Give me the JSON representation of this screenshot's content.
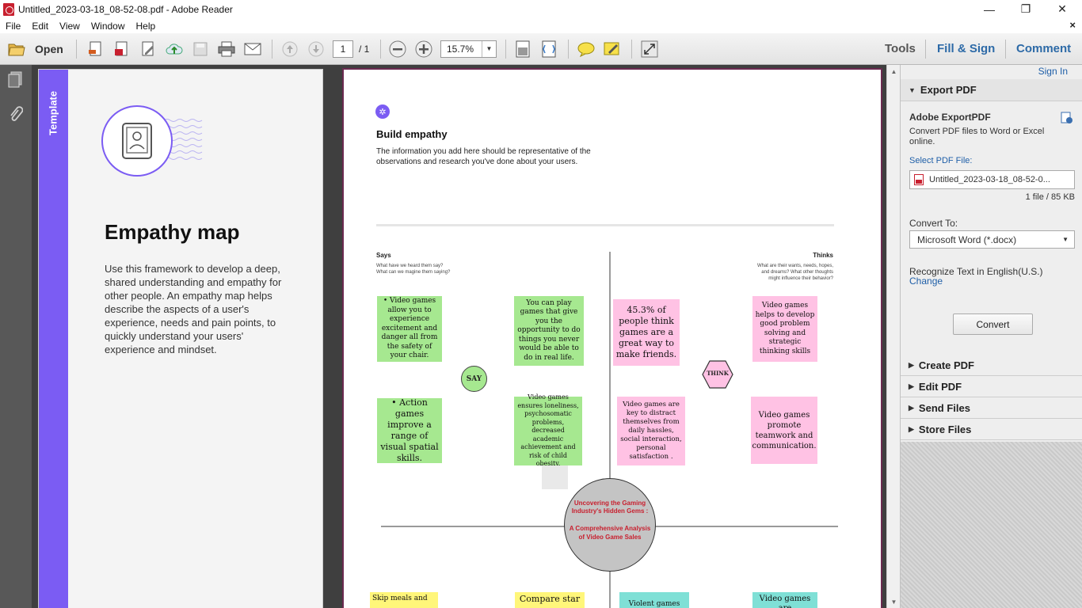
{
  "window": {
    "title": "Untitled_2023-03-18_08-52-08.pdf - Adobe Reader",
    "minimize": "—",
    "maximize": "❐",
    "close": "✕"
  },
  "menu": {
    "items": [
      "File",
      "Edit",
      "View",
      "Window",
      "Help"
    ],
    "close_doc": "×"
  },
  "toolbar": {
    "open_label": "Open",
    "page_current": "1",
    "page_total": "/ 1",
    "zoom": "15.7%",
    "tools": "Tools",
    "fill_sign": "Fill & Sign",
    "comment": "Comment"
  },
  "left_page": {
    "strip_label": "Template",
    "title": "Empathy map",
    "description": "Use this framework to develop a deep, shared understanding and empathy for other people. An empathy map helps describe the aspects of a user's experience, needs and pain points, to quickly understand your users' experience and mindset."
  },
  "right_page": {
    "heading": "Build empathy",
    "subtext": "The information you add here should be representative of the observations and research you've done about your users.",
    "says_label": "Says",
    "says_sub": "What have we heard them say?\nWhat can we magine them saying?",
    "thinks_label": "Thinks",
    "thinks_sub": "What are their wants, needs, hopes,\nand dreams? What other thoughts\nmight influence their behavior?",
    "say_badge": "SAY",
    "think_badge": "THINK",
    "center_title": "Uncovering the Gaming Industry's Hidden Gems :",
    "center_sub": "A Comprehensive Analysis of Video Game Sales",
    "notes": {
      "g1": "• Video games allow you to experience excitement and danger all from the safety of your chair.",
      "g2": "You can play games that give you the opportunity to do things you never would be able to do in real life.",
      "g3": "• Action games improve a range of visual spatial skills.",
      "g4": "Video games ensures loneliness, psychosomatic problems, decreased academic achievement and risk of child obesity.",
      "p1": "45.3% of people think games are a great way to make friends.",
      "p2": "Video games helps to develop good problem solving and strategic thinking skills",
      "p3": "Video games are key to distract themselves from daily hassles, social interaction, personal satisfaction .",
      "p4": "Video games promote teamwork and communication.",
      "y1": "Skip meals and",
      "y2": "Compare star",
      "t1": "Violent games",
      "t2": "Video games are"
    }
  },
  "right_panel": {
    "sign_in": "Sign In",
    "export_pdf": "Export PDF",
    "adobe_export": "Adobe ExportPDF",
    "export_desc": "Convert PDF files to Word or Excel online.",
    "select_label": "Select PDF File:",
    "file_name": "Untitled_2023-03-18_08-52-0...",
    "file_info": "1 file / 85 KB",
    "convert_to_label": "Convert To:",
    "convert_to_value": "Microsoft Word (*.docx)",
    "recognize": "Recognize Text in English(U.S.)",
    "change": "Change",
    "convert_btn": "Convert",
    "sections": [
      "Create PDF",
      "Edit PDF",
      "Send Files",
      "Store Files"
    ]
  },
  "colors": {
    "accent_purple": "#7b5cf3",
    "link_blue": "#1f5fa8",
    "sticky_green": "#a6e890",
    "sticky_pink": "#ffc2e4"
  }
}
